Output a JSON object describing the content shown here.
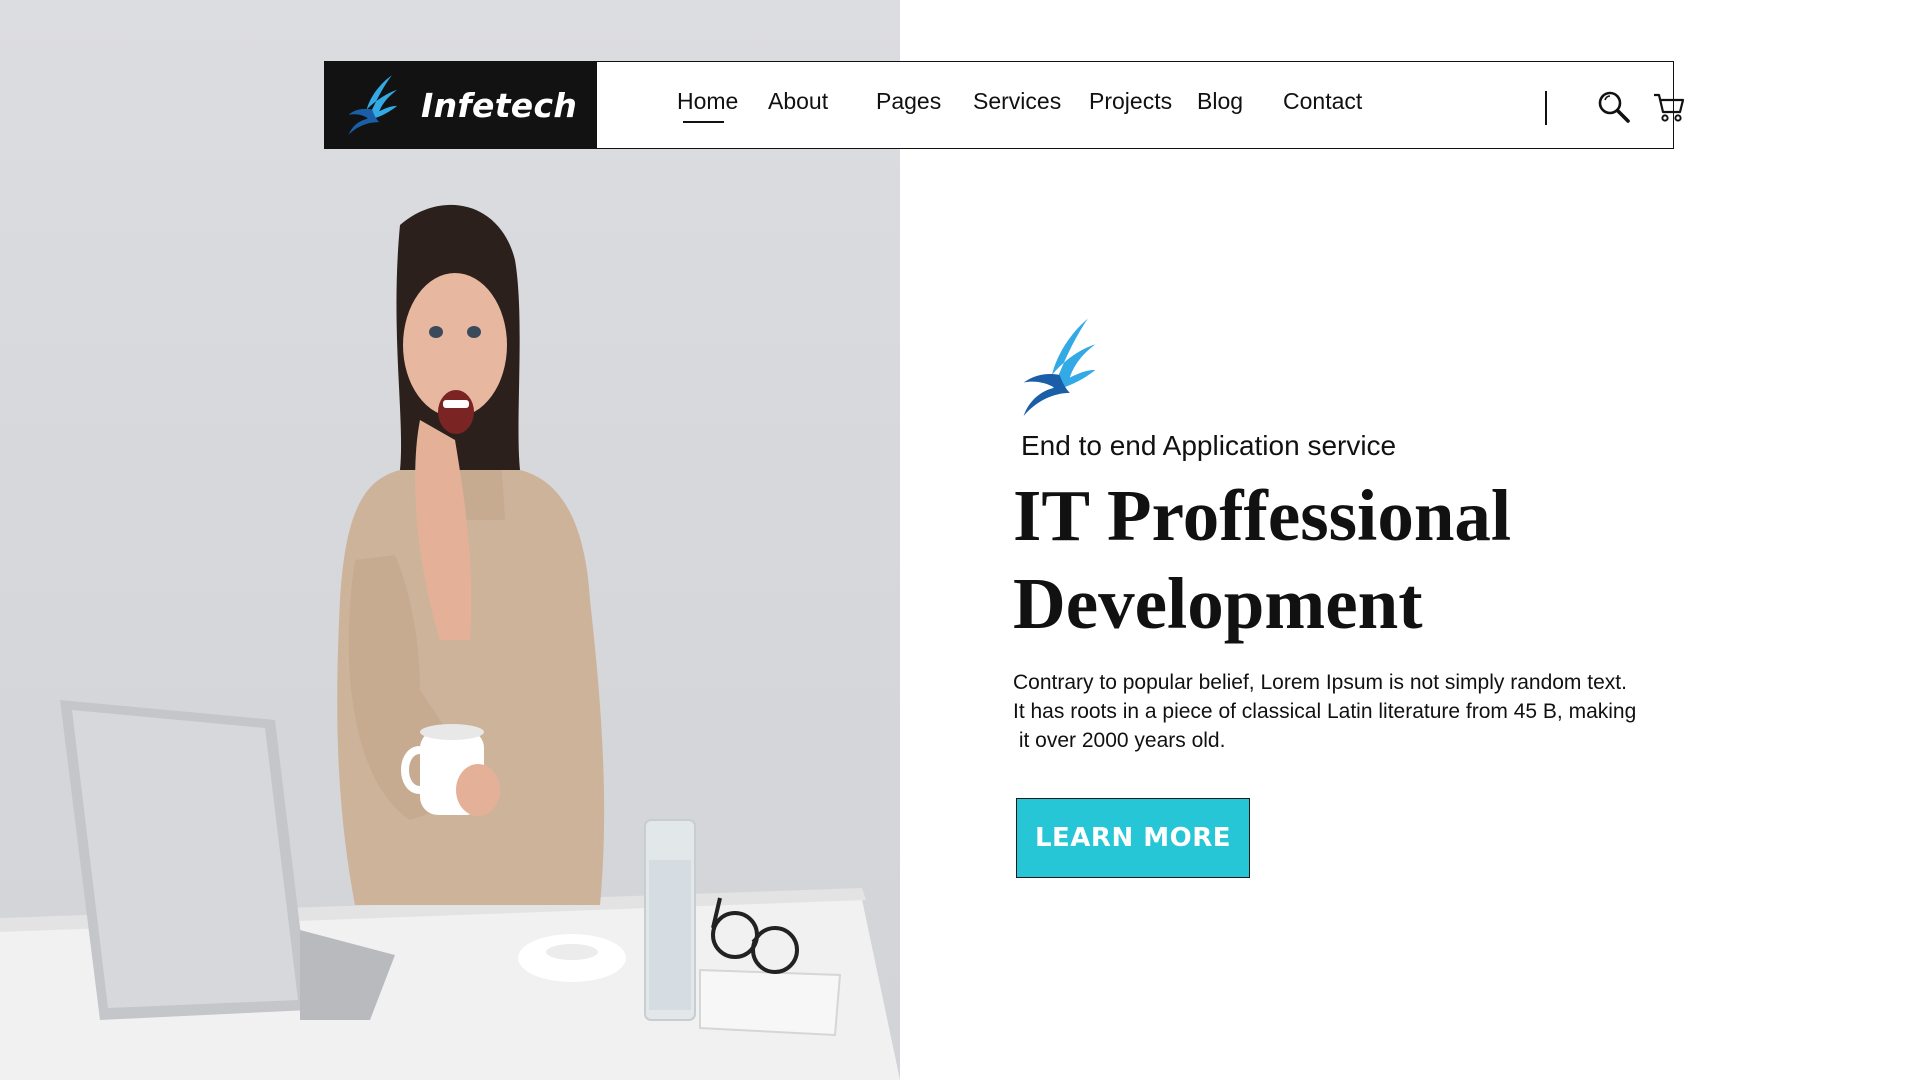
{
  "brand": {
    "name": "Infetech",
    "logo_icon": "bird-wing-logo-icon",
    "colors": {
      "logo_light": "#33a9e6",
      "logo_dark": "#1a5ea8",
      "brand_bg": "#121212"
    }
  },
  "nav": {
    "items": [
      {
        "label": "Home",
        "active": true
      },
      {
        "label": "About",
        "active": false
      },
      {
        "label": "Pages",
        "active": false
      },
      {
        "label": "Services",
        "active": false
      },
      {
        "label": "Projects",
        "active": false
      },
      {
        "label": "Blog",
        "active": false
      },
      {
        "label": "Contact",
        "active": false
      }
    ],
    "icons": [
      "search-icon",
      "cart-icon"
    ]
  },
  "hero": {
    "tagline": "End to end Application service",
    "title_lines": [
      "IT Proffessional",
      "Development"
    ],
    "description_lines": [
      "Contrary to popular belief, Lorem Ipsum is not simply random text.",
      "It has roots in a piece of classical Latin literature from 45 B, making",
      " it over 2000 years old."
    ],
    "cta_label": "LEARN MORE",
    "cta_color": "#26c6d6"
  }
}
